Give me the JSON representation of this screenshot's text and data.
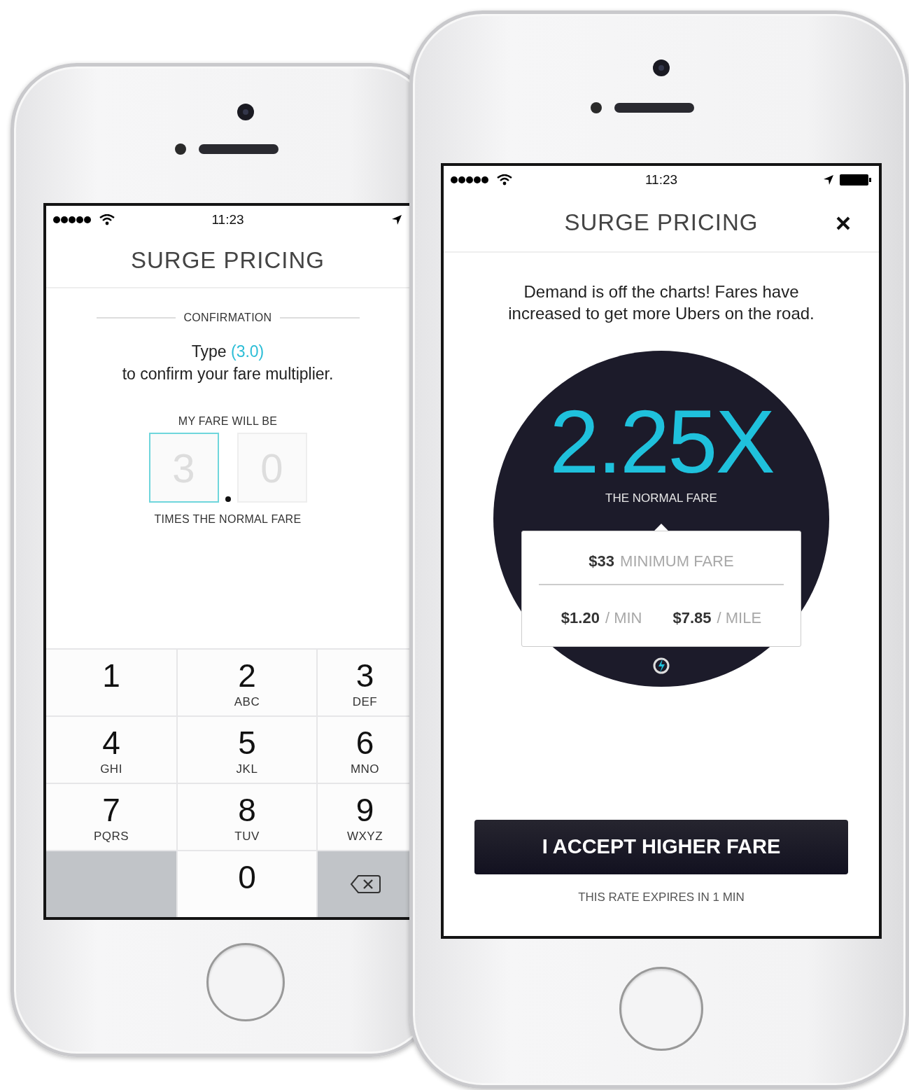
{
  "back_phone": {
    "status_bar": {
      "time": "11:23"
    },
    "title": "SURGE PRICING",
    "section_label": "CONFIRMATION",
    "instruction": {
      "lead": "Type",
      "code": "(3.0)",
      "rest": "to confirm your fare multiplier."
    },
    "fare_label": "MY FARE WILL BE",
    "digit_fields": [
      {
        "placeholder": "3",
        "selected": true
      },
      {
        "placeholder": "0",
        "selected": false
      }
    ],
    "fare_caption": "TIMES THE NORMAL FARE",
    "keypad": [
      {
        "kind": "digit",
        "digit": "1"
      },
      {
        "kind": "digit",
        "digit": "2",
        "letters": "ABC"
      },
      {
        "kind": "digit",
        "digit": "3",
        "letters": "DEF"
      },
      {
        "kind": "digit",
        "digit": "4",
        "letters": "GHI"
      },
      {
        "kind": "digit",
        "digit": "5",
        "letters": "JKL"
      },
      {
        "kind": "digit",
        "digit": "6",
        "letters": "MNO"
      },
      {
        "kind": "digit",
        "digit": "7",
        "letters": "PQRS"
      },
      {
        "kind": "digit",
        "digit": "8",
        "letters": "TUV"
      },
      {
        "kind": "digit",
        "digit": "9",
        "letters": "WXYZ"
      },
      {
        "kind": "blank"
      },
      {
        "kind": "digit",
        "digit": "0"
      },
      {
        "kind": "delete"
      }
    ]
  },
  "front_phone": {
    "status_bar": {
      "time": "11:23"
    },
    "title": "SURGE PRICING",
    "message": "Demand is off the charts! Fares have increased to get more Ubers on the road.",
    "multiplier": "2.25X",
    "multiplier_caption": "THE NORMAL FARE",
    "minimum_fare": {
      "amount": "$33",
      "label": "MINIMUM FARE"
    },
    "rates": [
      {
        "amount": "$1.20",
        "unit": "/ MIN"
      },
      {
        "amount": "$7.85",
        "unit": "/ MILE"
      }
    ],
    "accept_button": "I ACCEPT HIGHER FARE",
    "expiry_note": "THIS RATE EXPIRES IN 1 MIN"
  }
}
